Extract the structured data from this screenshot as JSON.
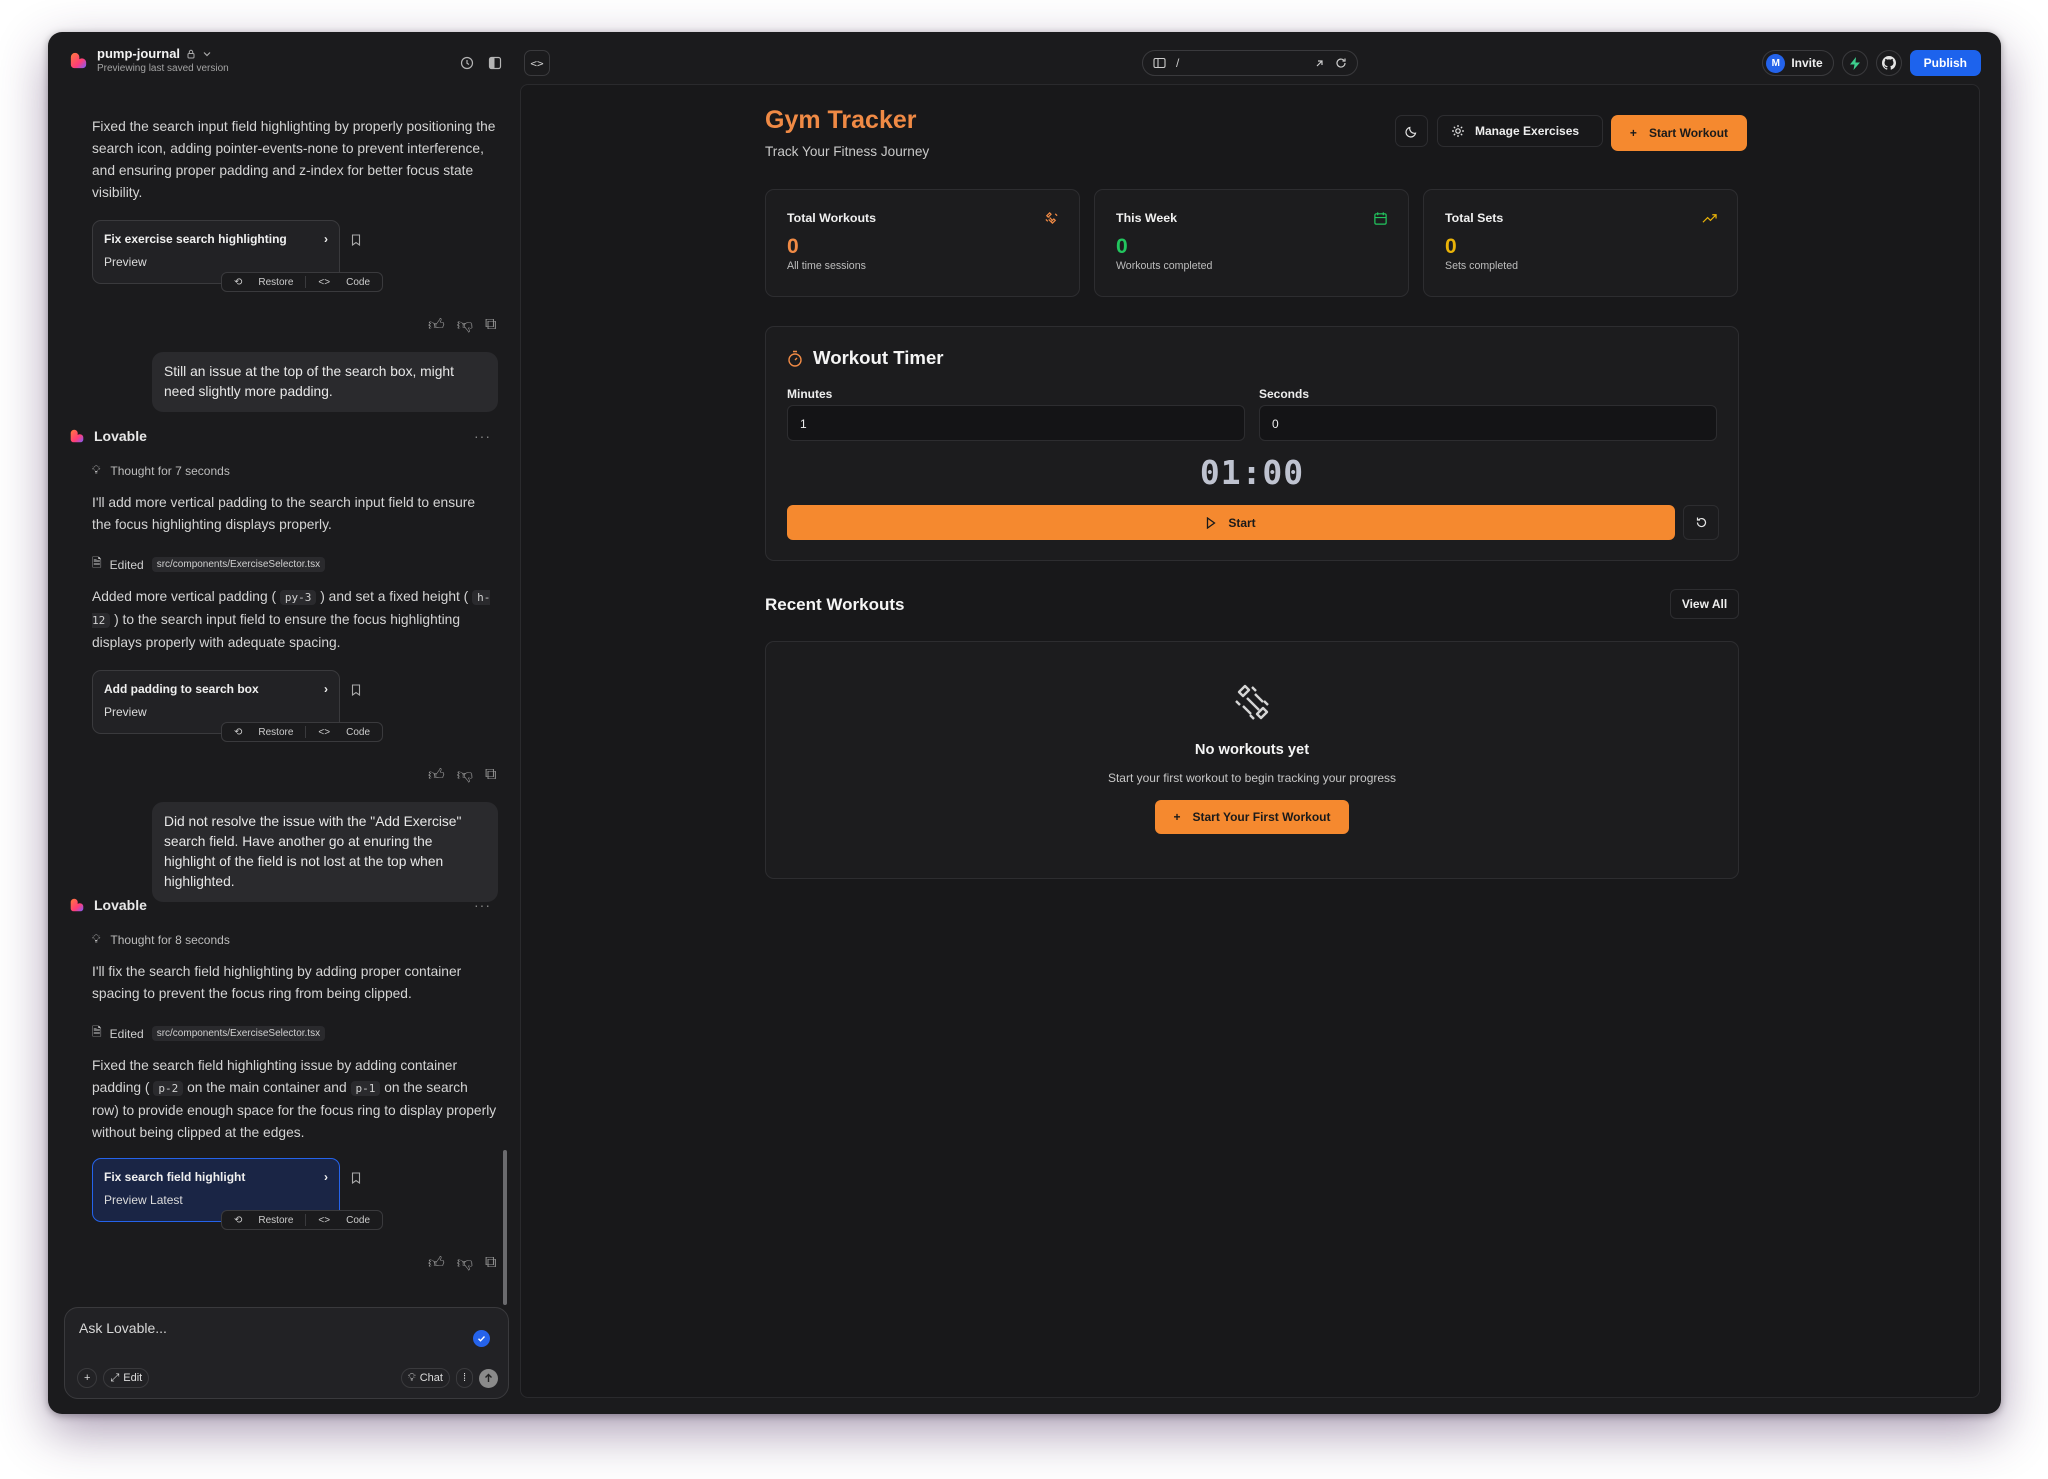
{
  "topbar": {
    "project_name": "pump-journal",
    "project_sub": "Previewing last saved version",
    "url_path": "/",
    "invite_label": "Invite",
    "avatar_initial": "M",
    "publish_label": "Publish"
  },
  "chat": {
    "msg1_text": "Fixed the search input field highlighting by properly positioning the search icon, adding pointer-events-none to prevent interference, and ensuring proper padding and z-index for better focus state visibility.",
    "card1_title": "Fix exercise search highlighting",
    "card1_preview": "Preview",
    "restore_label": "Restore",
    "code_label": "Code",
    "user1": "Still an issue at the top of the search box, might need slightly more padding.",
    "assistant_name": "Lovable",
    "thought1": "Thought for 7 seconds",
    "reply1": "I'll add more vertical padding to the search input field to ensure the focus highlighting displays properly.",
    "edited_label": "Edited",
    "file_path": "src/components/ExerciseSelector.tsx",
    "reply1b_a": "Added more vertical padding (",
    "reply1b_code1": "py-3",
    "reply1b_b": ") and set a fixed height (",
    "reply1b_code2": "h-12",
    "reply1b_c": ") to the search input field to ensure the focus highlighting displays properly with adequate spacing.",
    "card2_title": "Add padding to search box",
    "card2_preview": "Preview",
    "user2": "Did not resolve the issue with the \"Add Exercise\" search field. Have another go at enuring the highlight of the field is not lost at the top when highlighted.",
    "thought2": "Thought for 8 seconds",
    "reply2": "I'll fix the search field highlighting by adding proper container spacing to prevent the focus ring from being clipped.",
    "reply2b_a": "Fixed the search field highlighting issue by adding container padding (",
    "reply2b_code1": "p-2",
    "reply2b_b": "on the main container and",
    "reply2b_code2": "p-1",
    "reply2b_c": "on the search row) to provide enough space for the focus ring to display properly without being clipped at the edges.",
    "card3_title": "Fix search field highlight",
    "card3_preview": "Preview Latest",
    "input_placeholder": "Ask Lovable...",
    "edit_label": "Edit",
    "chat_label": "Chat"
  },
  "app": {
    "title": "Gym Tracker",
    "subtitle": "Track Your Fitness Journey",
    "manage_label": "Manage Exercises",
    "start_workout_label": "Start Workout",
    "stats": [
      {
        "label": "Total Workouts",
        "value": "0",
        "desc": "All time sessions",
        "color": "#f08a45",
        "icon": "dumbbell-icon"
      },
      {
        "label": "This Week",
        "value": "0",
        "desc": "Workouts completed",
        "color": "#22c55e",
        "icon": "calendar-icon"
      },
      {
        "label": "Total Sets",
        "value": "0",
        "desc": "Sets completed",
        "color": "#eab308",
        "icon": "trending-up-icon"
      }
    ],
    "timer": {
      "title": "Workout Timer",
      "minutes_label": "Minutes",
      "minutes_value": "1",
      "seconds_label": "Seconds",
      "seconds_value": "0",
      "display": "01:00",
      "start_label": "Start"
    },
    "recent": {
      "title": "Recent Workouts",
      "view_all": "View All",
      "empty_title": "No workouts yet",
      "empty_sub": "Start your first workout to begin tracking your progress",
      "empty_button": "Start Your First Workout"
    },
    "accent": "#f5892f"
  }
}
